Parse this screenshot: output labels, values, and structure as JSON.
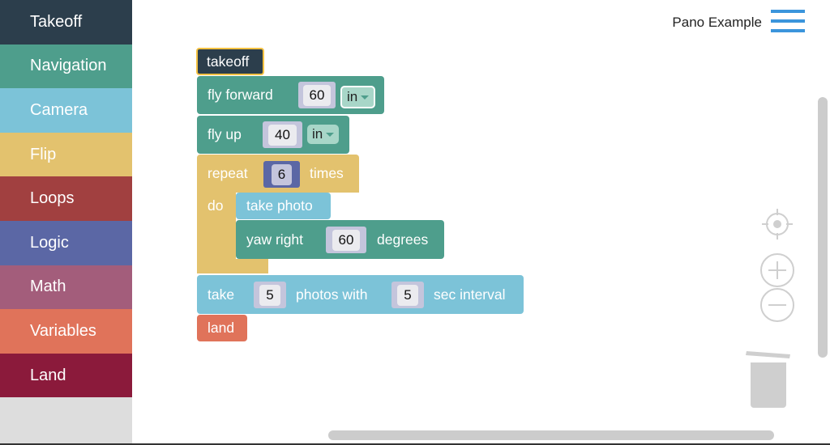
{
  "sidebar": {
    "items": [
      {
        "label": "Takeoff",
        "color": "#2c3e4c"
      },
      {
        "label": "Navigation",
        "color": "#4e9e8c"
      },
      {
        "label": "Camera",
        "color": "#7cc3d8"
      },
      {
        "label": "Flip",
        "color": "#e3c26e"
      },
      {
        "label": "Loops",
        "color": "#a14040"
      },
      {
        "label": "Logic",
        "color": "#5b67a5"
      },
      {
        "label": "Math",
        "color": "#a35d7b"
      },
      {
        "label": "Variables",
        "color": "#e0735a"
      },
      {
        "label": "Land",
        "color": "#8b1a3b"
      }
    ]
  },
  "header": {
    "title": "Pano Example",
    "menu_icon": "hamburger-icon"
  },
  "blocks": {
    "takeoff": "takeoff",
    "fly_forward": {
      "label": "fly forward",
      "value": "60",
      "unit": "in"
    },
    "fly_up": {
      "label": "fly up",
      "value": "40",
      "unit": "in"
    },
    "repeat": {
      "label": "repeat",
      "value": "6",
      "suffix": "times",
      "do": "do"
    },
    "take_photo": "take photo",
    "yaw_right": {
      "label": "yaw right",
      "value": "60",
      "suffix": "degrees"
    },
    "take_photos": {
      "label": "take",
      "count": "5",
      "middle": "photos with",
      "interval": "5",
      "suffix": "sec interval"
    },
    "land": "land"
  },
  "controls": [
    "recenter-icon",
    "zoom-in-icon",
    "zoom-out-icon",
    "trash-icon"
  ]
}
